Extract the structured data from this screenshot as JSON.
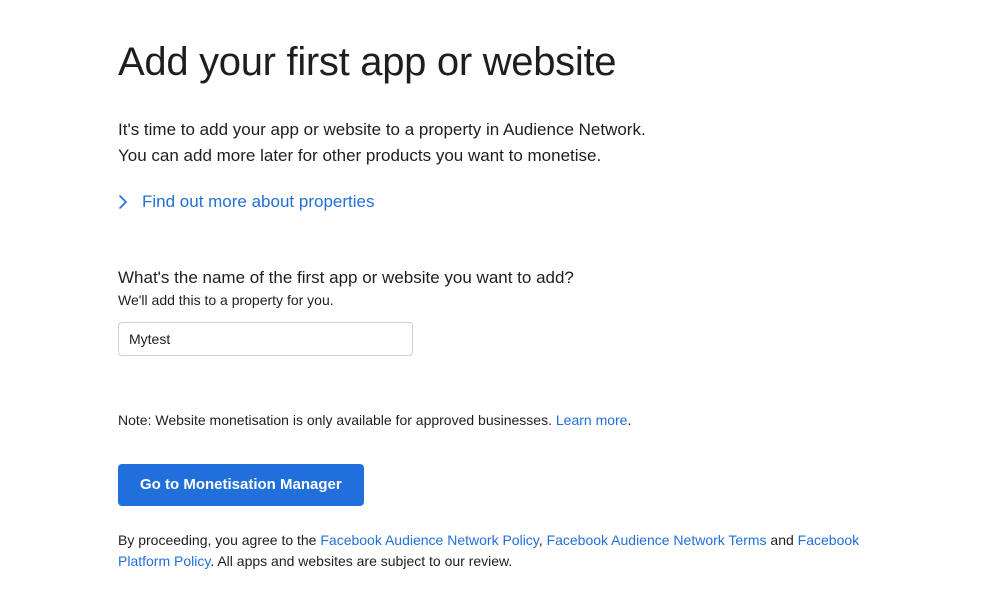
{
  "heading": "Add your first app or website",
  "intro_line1": "It's time to add your app or website to a property in Audience Network.",
  "intro_line2": "You can add more later for other products you want to monetise.",
  "find_out_more": "Find out more about properties",
  "question": "What's the name of the first app or website you want to add?",
  "sub_question": "We'll add this to a property for you.",
  "input_value": "Mytest",
  "note_prefix": "Note: Website monetisation is only available for approved businesses. ",
  "learn_more": "Learn more",
  "note_suffix": ".",
  "cta_label": "Go to Monetisation Manager",
  "legal_prefix": "By proceeding, you agree to the ",
  "legal_link1": "Facebook Audience Network Policy",
  "legal_sep1": ", ",
  "legal_link2": "Facebook Audience Network Terms",
  "legal_sep2": " and ",
  "legal_link3": "Facebook Platform Policy",
  "legal_suffix": ". All apps and websites are subject to our review."
}
